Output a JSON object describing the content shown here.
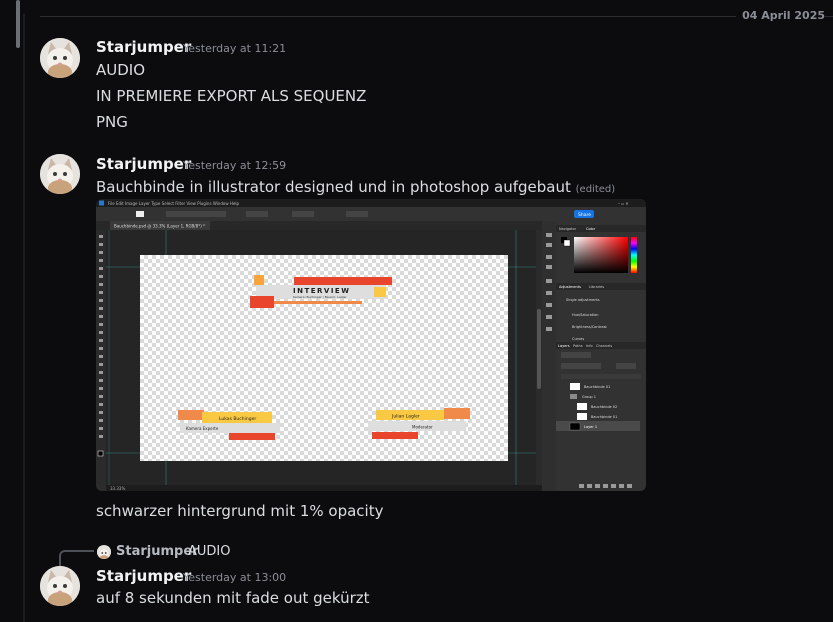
{
  "date_divider": "04 April 2025",
  "messages": [
    {
      "username": "Starjumper",
      "timestamp": "Yesterday at 11:21",
      "lines": [
        "AUDIO",
        "IN PREMIERE EXPORT ALS SEQUENZ",
        "PNG"
      ]
    },
    {
      "username": "Starjumper",
      "timestamp": "Yesterday at 12:59",
      "text": "Bauchbinde in illustrator designed und in photoshop aufgebaut",
      "edited": "(edited)",
      "after_image": "schwarzer hintergrund mit 1% opacity"
    },
    {
      "reply_to": {
        "username": "Starjumper",
        "text": "AUDIO"
      },
      "username": "Starjumper",
      "timestamp": "Yesterday at 13:00",
      "text": "auf 8 sekunden mit fade out gekürzt"
    }
  ],
  "screenshot": {
    "doc_tab": "Bauchbinde.psd @ 33.3% (Layer 1, RGB/8*) *",
    "share_button": "Share",
    "zoom": "33.33%",
    "interview_title": "INTERVIEW",
    "interview_subtitle": "Kamera: Buchinger / Bauom: Laqler",
    "left_name": "Lukas Buchinger",
    "left_role": "Kamera Experte",
    "right_name": "Julian Lagler",
    "right_role": "Moderator",
    "panel_tabs": [
      "Navigator",
      "Color"
    ],
    "adjust_tabs": [
      "Adjustments",
      "Libraries"
    ],
    "adjust_items": [
      "Single adjustments",
      "Hue/Saturation",
      "Brightness/Contrast",
      "Curves"
    ],
    "layers_tabs": [
      "Layers",
      "Paths",
      "Info",
      "Channels"
    ],
    "layers": [
      "Bauchbinde 01",
      "Group 1",
      "Bauchbinde 02",
      "Bauchbinde 01",
      "Layer 1"
    ]
  }
}
